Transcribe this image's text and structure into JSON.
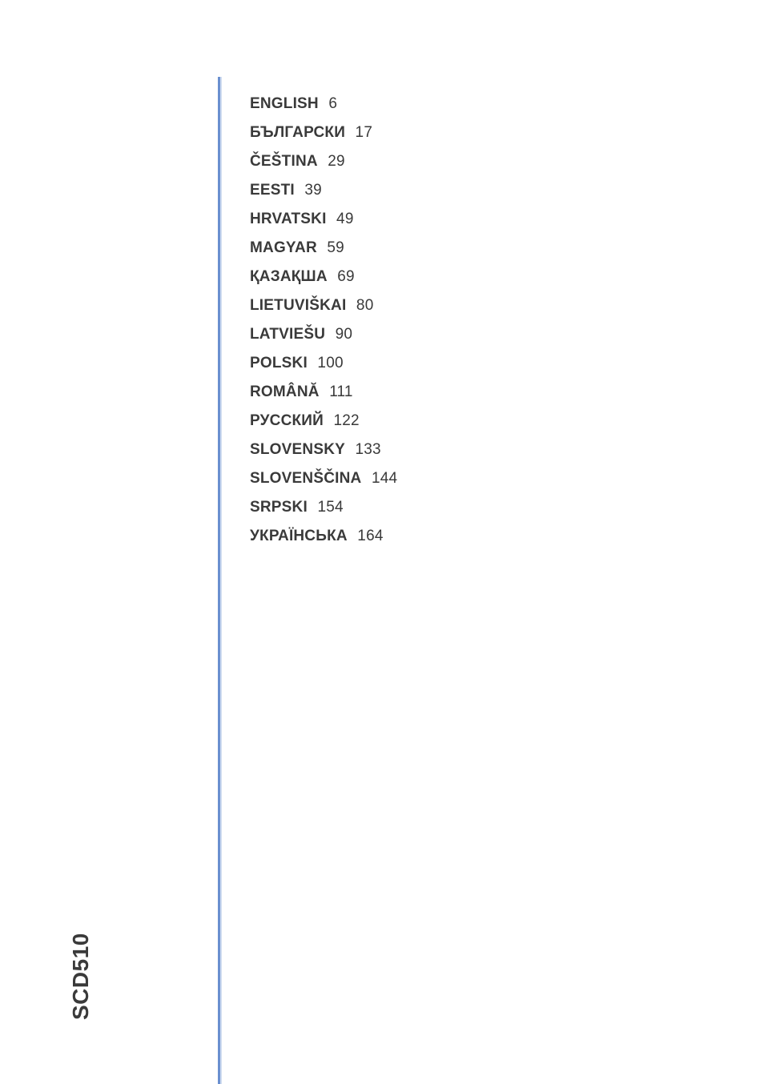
{
  "model": "SCD510",
  "toc": [
    {
      "lang": "ENGLISH",
      "page": 6
    },
    {
      "lang": "БЪЛГАРСКИ",
      "page": 17
    },
    {
      "lang": "ČEŠTINA",
      "page": 29
    },
    {
      "lang": "EESTI",
      "page": 39
    },
    {
      "lang": "HRVATSKI",
      "page": 49
    },
    {
      "lang": "MAGYAR",
      "page": 59
    },
    {
      "lang": "ҚАЗАҚША",
      "page": 69
    },
    {
      "lang": "LIETUVIŠKAI",
      "page": 80
    },
    {
      "lang": "LATVIEŠU",
      "page": 90
    },
    {
      "lang": "POLSKI",
      "page": 100
    },
    {
      "lang": "ROMÂNĂ",
      "page": 111
    },
    {
      "lang": "РУССКИЙ",
      "page": 122
    },
    {
      "lang": "SLOVENSKY",
      "page": 133
    },
    {
      "lang": "SLOVENŠČINA",
      "page": 144
    },
    {
      "lang": "SRPSKI",
      "page": 154
    },
    {
      "lang": "УКРАЇНСЬКА",
      "page": 164
    }
  ]
}
